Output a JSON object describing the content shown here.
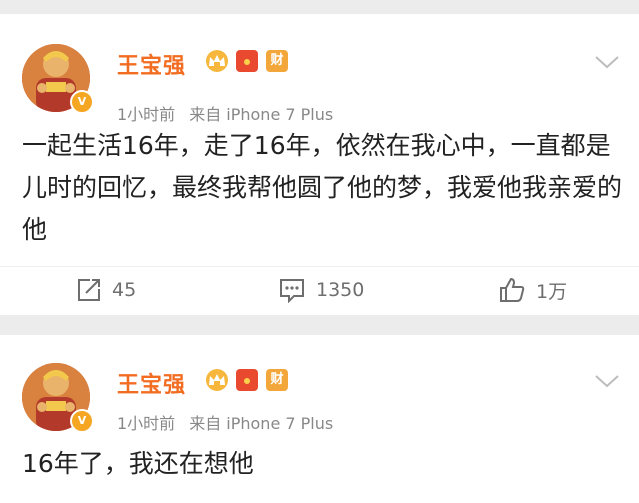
{
  "posts": [
    {
      "user": {
        "name": "王宝强",
        "badge_wealth_label": "财"
      },
      "meta": {
        "time": "1小时前",
        "source": "来自 iPhone 7 Plus"
      },
      "text": "一起生活16年，走了16年，依然在我心中，一直都是儿时的回忆，最终我帮他圆了他的梦，我爱他我亲爱的他",
      "actions": {
        "repost_count": "45",
        "comment_count": "1350",
        "like_count": "1万"
      }
    },
    {
      "user": {
        "name": "王宝强",
        "badge_wealth_label": "财"
      },
      "meta": {
        "time": "1小时前",
        "source": "来自 iPhone 7 Plus"
      },
      "text": "16年了，我还在想他"
    }
  ],
  "icons": {
    "verified": "verified-v-icon",
    "repost": "repost-icon",
    "comment": "comment-icon",
    "like": "thumbs-up-icon",
    "more": "chevron-down-icon"
  },
  "colors": {
    "username": "#f26d21",
    "verified_badge": "#f5a623",
    "text": "#222222",
    "meta": "#888888",
    "background": "#ececec"
  }
}
